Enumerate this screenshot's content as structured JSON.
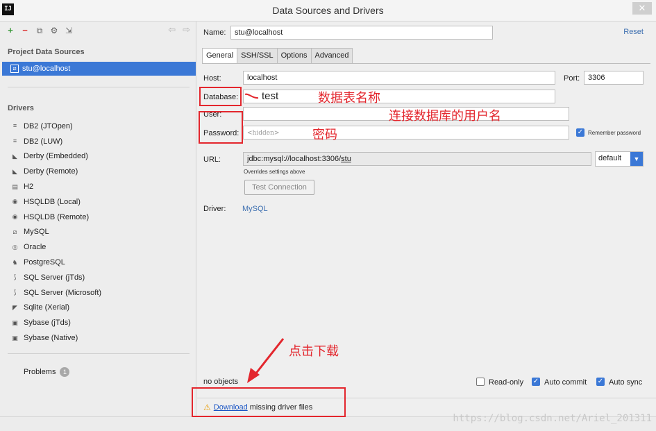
{
  "window": {
    "title": "Data Sources and Drivers",
    "app_icon": "IJ"
  },
  "sidebar": {
    "project_section": "Project Data Sources",
    "selected_source": "stu@localhost",
    "drivers_section": "Drivers",
    "drivers": [
      "DB2 (JTOpen)",
      "DB2 (LUW)",
      "Derby (Embedded)",
      "Derby (Remote)",
      "H2",
      "HSQLDB (Local)",
      "HSQLDB (Remote)",
      "MySQL",
      "Oracle",
      "PostgreSQL",
      "SQL Server (jTds)",
      "SQL Server (Microsoft)",
      "Sqlite (Xerial)",
      "Sybase (jTds)",
      "Sybase (Native)"
    ],
    "problems_label": "Problems",
    "problems_count": "1"
  },
  "form": {
    "name_label": "Name:",
    "name_value": "stu@localhost",
    "reset_label": "Reset",
    "tabs": [
      "General",
      "SSH/SSL",
      "Options",
      "Advanced"
    ],
    "host_label": "Host:",
    "host_value": "localhost",
    "port_label": "Port:",
    "port_value": "3306",
    "database_label": "Database:",
    "database_value": "test",
    "user_label": "User:",
    "user_value": "",
    "password_label": "Password:",
    "password_placeholder": "<hidden>",
    "remember_label": "Remember password",
    "url_label": "URL:",
    "url_prefix": "jdbc:mysql://localhost:3306/",
    "url_db": "stu",
    "url_hint": "Overrides settings above",
    "url_mode": "default",
    "test_button": "Test Connection",
    "driver_label": "Driver:",
    "driver_value": "MySQL",
    "no_objects": "no objects",
    "readonly_label": "Read-only",
    "autocommit_label": "Auto commit",
    "autosync_label": "Auto sync",
    "download_link": "Download",
    "download_rest": " missing driver files"
  },
  "annotations": {
    "db_note": "数据表名称",
    "user_note": "连接数据库的用户名",
    "password_note": "密码",
    "download_note": "点击下载",
    "watermark": "https://blog.csdn.net/Ariel_201311"
  }
}
